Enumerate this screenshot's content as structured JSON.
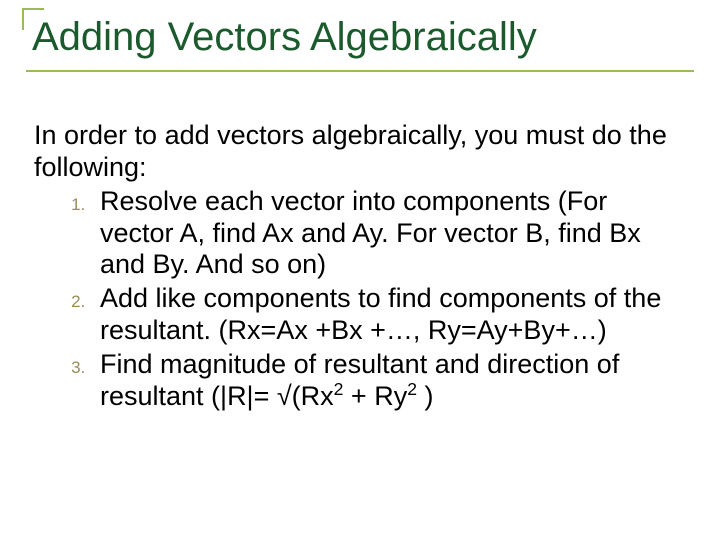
{
  "title": "Adding Vectors Algebraically",
  "intro": "In order to add vectors algebraically, you must do the following:",
  "steps": {
    "s1": "Resolve each vector into components (For vector A, find Ax and Ay. For vector B, find Bx and By. And so on)",
    "s2": "Add like components to find components of the resultant. (Rx=Ax +Bx +…, Ry=Ay+By+…)",
    "s3_a": "Find magnitude of resultant and direction of resultant (|R|= √(Rx",
    "s3_sup1": "2",
    "s3_b": "  + Ry",
    "s3_sup2": "2",
    "s3_c": "  )"
  }
}
